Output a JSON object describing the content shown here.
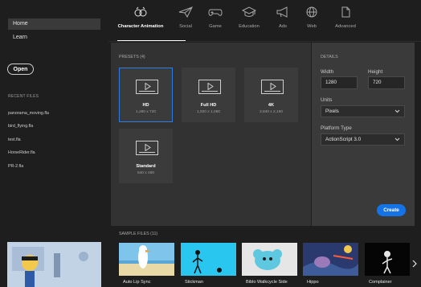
{
  "sidebar": {
    "nav": [
      {
        "label": "Home",
        "active": true
      },
      {
        "label": "Learn",
        "active": false
      }
    ],
    "open_label": "Open",
    "recent_header": "RECENT FILES",
    "recent_files": [
      "panorama_moving.fla",
      "bird_flying.fla",
      "test.fla",
      "HorseRider.fla",
      "PR-2.fla"
    ]
  },
  "categories": [
    {
      "label": "Character Animation",
      "icon": "character-animation-icon",
      "active": true
    },
    {
      "label": "Social",
      "icon": "paper-plane-icon",
      "active": false
    },
    {
      "label": "Game",
      "icon": "gamepad-icon",
      "active": false
    },
    {
      "label": "Education",
      "icon": "graduation-cap-icon",
      "active": false
    },
    {
      "label": "Ads",
      "icon": "megaphone-icon",
      "active": false
    },
    {
      "label": "Web",
      "icon": "globe-icon",
      "active": false
    },
    {
      "label": "Advanced",
      "icon": "document-icon",
      "active": false
    }
  ],
  "presets": {
    "header": "PRESETS (4)",
    "items": [
      {
        "name": "HD",
        "size": "1,280 x 720",
        "selected": true
      },
      {
        "name": "Full HD",
        "size": "1,920 x 1,080",
        "selected": false
      },
      {
        "name": "4K",
        "size": "3,840 x 2,160",
        "selected": false
      },
      {
        "name": "Standard",
        "size": "640 x 480",
        "selected": false
      }
    ]
  },
  "details": {
    "header": "DETAILS",
    "width_label": "Width",
    "width_value": "1280",
    "height_label": "Height",
    "height_value": "720",
    "units_label": "Units",
    "units_value": "Pixels",
    "platform_label": "Platform Type",
    "platform_value": "ActionScript 3.0",
    "create_label": "Create"
  },
  "samples": {
    "header": "SAMPLE FILES (11)",
    "items": [
      "Auto Lip Sync",
      "Stickman",
      "Biblo Walkcycle Side",
      "Hippo",
      "Complainer"
    ]
  },
  "colors": {
    "accent": "#1473e6",
    "selected_border": "#2f7be0",
    "panel": "#323232",
    "details_panel": "#3a3a3a"
  }
}
